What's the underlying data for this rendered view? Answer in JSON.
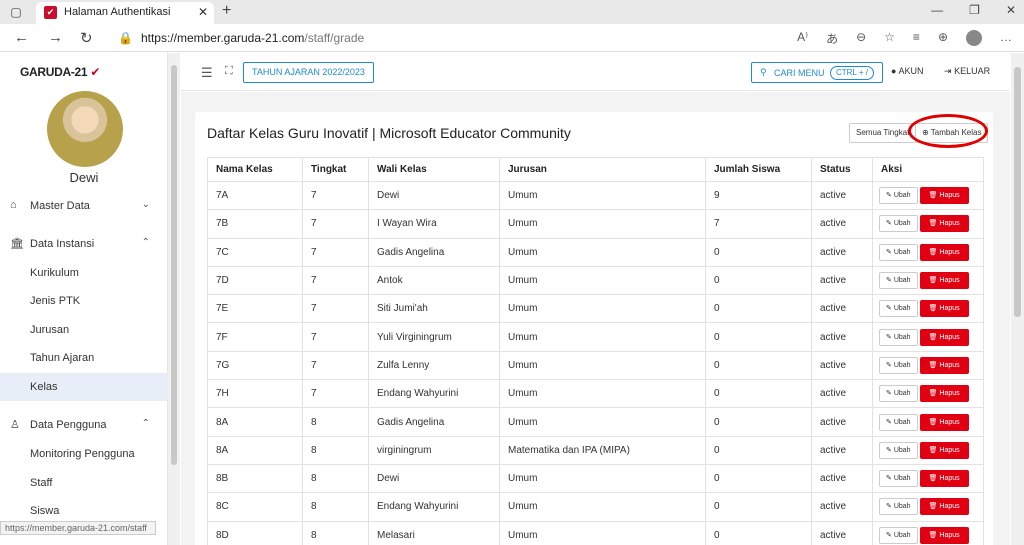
{
  "browser": {
    "tab_title": "Halaman Authentikasi",
    "url_host": "https://member.garuda-21.com",
    "url_path": "/staff/grade",
    "status_url": "https://member.garuda-21.com/staff"
  },
  "sidebar": {
    "logo": "GARUDA-21",
    "profile_name": "Dewi",
    "groups": [
      {
        "label": "Master Data"
      },
      {
        "label": "Data Instansi"
      },
      {
        "label": "Data Pengguna"
      }
    ],
    "instansi_items": [
      "Kurikulum",
      "Jenis PTK",
      "Jurusan",
      "Tahun Ajaran",
      "Kelas"
    ],
    "pengguna_items": [
      "Monitoring Pengguna",
      "Staff",
      "Siswa"
    ]
  },
  "appbar": {
    "year_button": "TAHUN AJARAN 2022/2023",
    "search_label": "CARI MENU",
    "search_shortcut": "CTRL + /",
    "akun": "AKUN",
    "keluar": "KELUAR"
  },
  "card": {
    "title": "Daftar Kelas Guru Inovatif | Microsoft Educator Community",
    "semua_label": "Semua Tingkat",
    "tambah_label": "Tambah Kelas",
    "headers": [
      "Nama Kelas",
      "Tingkat",
      "Wali Kelas",
      "Jurusan",
      "Jumlah Siswa",
      "Status",
      "Aksi"
    ],
    "ubah_label": "Ubah",
    "hapus_label": "Hapus",
    "rows": [
      [
        "7A",
        "7",
        "Dewi",
        "Umum",
        "9",
        "active"
      ],
      [
        "7B",
        "7",
        "I Wayan Wira",
        "Umum",
        "7",
        "active"
      ],
      [
        "7C",
        "7",
        "Gadis Angelina",
        "Umum",
        "0",
        "active"
      ],
      [
        "7D",
        "7",
        "Antok",
        "Umum",
        "0",
        "active"
      ],
      [
        "7E",
        "7",
        "Siti Jumi'ah",
        "Umum",
        "0",
        "active"
      ],
      [
        "7F",
        "7",
        "Yuli Virginingrum",
        "Umum",
        "0",
        "active"
      ],
      [
        "7G",
        "7",
        "Zulfa Lenny",
        "Umum",
        "0",
        "active"
      ],
      [
        "7H",
        "7",
        "Endang Wahyurini",
        "Umum",
        "0",
        "active"
      ],
      [
        "8A",
        "8",
        "Gadis Angelina",
        "Umum",
        "0",
        "active"
      ],
      [
        "8A",
        "8",
        "virginingrum",
        "Matematika dan IPA (MIPA)",
        "0",
        "active"
      ],
      [
        "8B",
        "8",
        "Dewi",
        "Umum",
        "0",
        "active"
      ],
      [
        "8C",
        "8",
        "Endang Wahyurini",
        "Umum",
        "0",
        "active"
      ],
      [
        "8D",
        "8",
        "Melasari",
        "Umum",
        "0",
        "active"
      ]
    ]
  },
  "colors": {
    "accent": "#1f8ad4",
    "danger": "#e00012",
    "highlight": "#e00000"
  }
}
